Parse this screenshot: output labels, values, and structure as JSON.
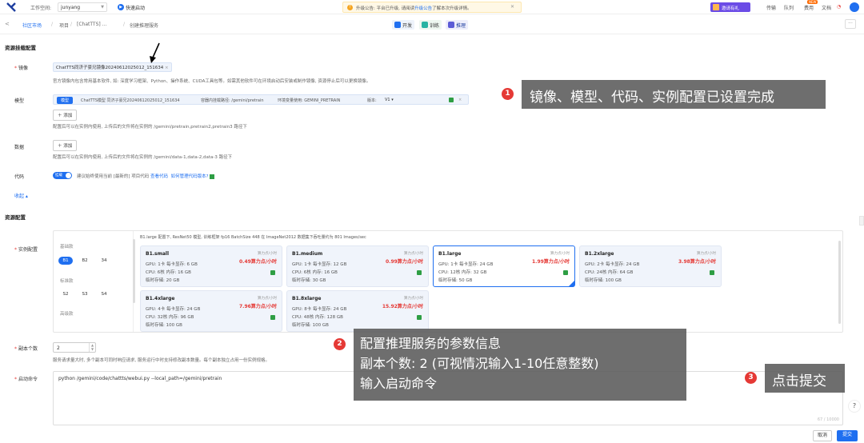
{
  "topbar": {
    "workspace_label": "工作空间:",
    "workspace_value": "junyang",
    "quick_start": "快速启动",
    "notice_prefix": "升级公告: 平台已升级, 请阅读",
    "notice_link": "升级公告",
    "notice_suffix": "了解本次升级详情。",
    "invite": "邀请有礼",
    "links": [
      "传输",
      "队列",
      "费用",
      "文档"
    ],
    "new_badge": "NEW"
  },
  "breadcrumb": {
    "back": "<",
    "root": "社区市场",
    "items": [
      "项目",
      "[ChatTTS] ...",
      "创建推理服务"
    ]
  },
  "phases": [
    "开发",
    "训练",
    "推理"
  ],
  "section_basic": {
    "title": "资源挂载配置",
    "image_label": "镜像",
    "image_tag": "ChatTTS同济子豪兄镜像20240612025012_151634",
    "image_hint": "官方镜像内包含常用基本软件, 如: 深度学习框架、Python、操作系统、CUDA工具包等。如需其他软件可在环境启动后安装或制作镜像, 资源停止后可以更换镜像。",
    "model_label": "模型",
    "model_type": "模型",
    "model_name": "ChatTTS模型 同济子豪兄20240612025012_151634",
    "model_path": "容器内挂载路径: /gemini/pretrain",
    "model_env": "环境变量使用: GEMINI_PRETRAIN",
    "model_version_label": "版本:",
    "model_version": "V1",
    "add_label": "添加",
    "model_hint": "配置后可以在实例内使用, 上传后的文件将在实例的 /gemini/pretrain,pretrain2,pretrain3 路径下",
    "data_label": "数据",
    "data_hint": "配置后可以在实例内使用, 上传后的文件将在实例的 /gemini/data-1,data-2,data-3 路径下",
    "code_label": "代码",
    "code_toggle": "挂载",
    "code_hint": "建议始终使用当前 [最新的] 项目代码",
    "code_link1": "查看代码",
    "code_link2": "如何管理代码版本?",
    "collapse": "收起"
  },
  "section_resource": {
    "title": "资源配置",
    "instance_label": "实例配置",
    "categories": [
      {
        "title": "基础款",
        "chips": [
          "B1",
          "B2",
          "34"
        ],
        "active": 0
      },
      {
        "title": "标准款",
        "chips": [
          "S2",
          "S3",
          "S4"
        ]
      },
      {
        "title": "高级款",
        "chips": []
      }
    ],
    "desc": "B1.large 配置下, ResNet50 模型, 训练框架 fp16 BatchSize 448 在 ImageNet2012 数据集下吞吐量约为 801 Images/sec",
    "cards": [
      {
        "name": "B1.small",
        "unit": "算力点/小时",
        "price": "0.49算力点/小时",
        "gpu": "GPU: 1卡   每卡显存: 6 GB",
        "cpu": "CPU: 6核   内存: 16 GB",
        "disk": "临时存储: 20 GB"
      },
      {
        "name": "B1.medium",
        "unit": "算力点/小时",
        "price": "0.99算力点/小时",
        "gpu": "GPU: 1卡   每卡显存: 12 GB",
        "cpu": "CPU: 6核   内存: 16 GB",
        "disk": "临时存储: 30 GB"
      },
      {
        "name": "B1.large",
        "unit": "算力点/小时",
        "price": "1.99算力点/小时",
        "gpu": "GPU: 1卡   每卡显存: 24 GB",
        "cpu": "CPU: 12核   内存: 32 GB",
        "disk": "临时存储: 50 GB"
      },
      {
        "name": "B1.2xlarge",
        "unit": "算力点/小时",
        "price": "3.98算力点/小时",
        "gpu": "GPU: 2卡   每卡显存: 24 GB",
        "cpu": "CPU: 24核   内存: 64 GB",
        "disk": "临时存储: 100 GB"
      },
      {
        "name": "B1.4xlarge",
        "unit": "算力点/小时",
        "price": "7.96算力点/小时",
        "gpu": "GPU: 4卡   每卡显存: 24 GB",
        "cpu": "CPU: 32核   内存: 96 GB",
        "disk": "临时存储: 100 GB"
      },
      {
        "name": "B1.8xlarge",
        "unit": "算力点/小时",
        "price": "15.92算力点/小时",
        "gpu": "GPU: 8卡   每卡显存: 24 GB",
        "cpu": "CPU: 48核   内存: 128 GB",
        "disk": "临时存储: 100 GB"
      }
    ],
    "replica_label": "副本个数",
    "replica_value": "2",
    "replica_hint": "服务请求量大时, 多个副本可同时响应请求, 服务运行中时支持修改副本数量。每个副本独立占用一份实例规格。",
    "cmd_label": "启动命令",
    "cmd_value": "python /gemini/code/chattts/webui.py --local_path=/gemini/pretrain",
    "counter": "67 / 10000"
  },
  "footer": {
    "cancel": "取消",
    "submit": "提交"
  },
  "annotations": {
    "a1_num": "1",
    "a1_text": "镜像、模型、代码、实例配置已设置完成",
    "a2_num": "2",
    "a2_line1": "配置推理服务的参数信息",
    "a2_line2": "副本个数: 2 (可视情况输入1-10任意整数)",
    "a2_line3": "输入启动命令",
    "a3_num": "3",
    "a3_text": "点击提交"
  },
  "colors": {
    "accent": "#1f6ff0",
    "price": "#e53935",
    "annotation_bg": "#5a5a5a",
    "annotation_num": "#e53935"
  },
  "icons": [
    "logo-icon",
    "quick-start-icon",
    "warning-icon",
    "gift-icon",
    "user-avatar-icon",
    "help-icon"
  ]
}
